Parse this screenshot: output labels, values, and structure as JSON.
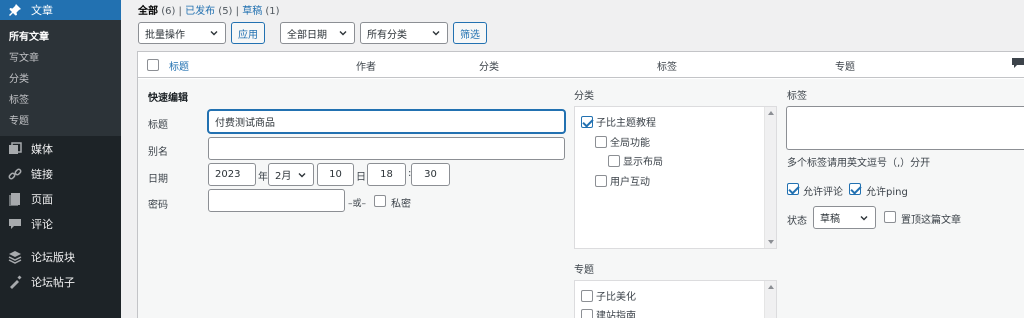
{
  "sidebar": {
    "posts_label": "文章",
    "sub_items": [
      "所有文章",
      "写文章",
      "分类",
      "标签",
      "专题"
    ],
    "media": "媒体",
    "links": "链接",
    "pages": "页面",
    "comments": "评论",
    "forum_sections": "论坛版块",
    "forum_posts": "论坛帖子",
    "accent": "#2271b1"
  },
  "filters": {
    "all": "全部",
    "all_count": "(6)",
    "sep": "|",
    "published": "已发布",
    "published_count": "(5)",
    "draft": "草稿",
    "draft_count": "(1)"
  },
  "toolbar": {
    "bulk_action": "批量操作",
    "apply": "应用",
    "all_dates": "全部日期",
    "all_categories": "所有分类",
    "filter": "筛选"
  },
  "columns": {
    "title": "标题",
    "author": "作者",
    "category": "分类",
    "tags": "标签",
    "topic": "专题"
  },
  "quick_edit": {
    "heading": "快速编辑",
    "title_label": "标题",
    "title_value": "付费测试商品",
    "slug_label": "别名",
    "slug_value": "",
    "date_label": "日期",
    "year": "2023",
    "year_suffix": "年",
    "month": "2月",
    "day": "10",
    "day_suffix": "日",
    "hour": "18",
    "colon": ":",
    "minute": "30",
    "password_label": "密码",
    "password_value": "",
    "or_text": "–或–",
    "private_label": "私密",
    "categories_label": "分类",
    "categories": [
      {
        "label": "子比主题教程",
        "checked": true
      },
      {
        "label": "全局功能",
        "checked": false
      },
      {
        "label": "显示布局",
        "checked": false
      },
      {
        "label": "用户互动",
        "checked": false
      }
    ],
    "topics_label": "专题",
    "topics": [
      {
        "label": "子比美化",
        "checked": false
      },
      {
        "label": "建站指南",
        "checked": false
      }
    ],
    "tags_label": "标签",
    "tags_hint": "多个标签请用英文逗号（,）分开",
    "allow_comments": "允许评论",
    "allow_ping": "允许ping",
    "status_label": "状态",
    "status_value": "草稿",
    "sticky_label": "置顶这篇文章"
  }
}
